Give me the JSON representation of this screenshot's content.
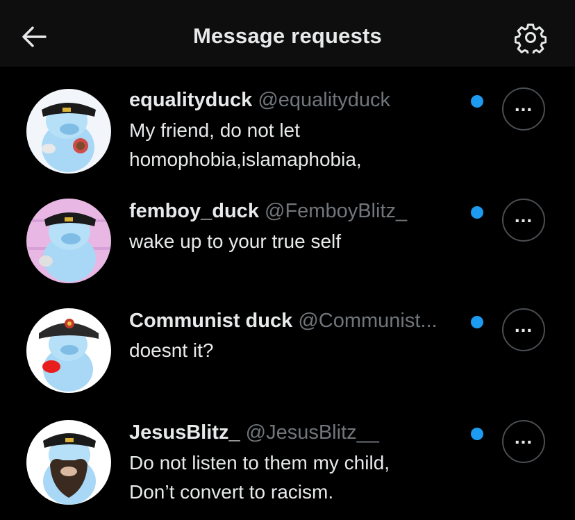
{
  "header": {
    "title": "Message requests",
    "back_icon": "arrow-left-icon",
    "settings_icon": "gear-icon"
  },
  "requests": [
    {
      "name": "equalityduck",
      "handle": "@equalityduck",
      "message_lines": [
        "My friend, do not let",
        "homophobia,islamaphobia,"
      ],
      "unread": true,
      "avatar_bg": "#f2f6fb"
    },
    {
      "name": "femboy_duck",
      "handle": "@FemboyBlitz_",
      "message_lines": [
        "wake up to your true self"
      ],
      "unread": true,
      "avatar_bg": "#e9b7e4"
    },
    {
      "name": "Communist duck",
      "handle": "@Communist...",
      "message_lines": [
        "doesnt it?"
      ],
      "unread": true,
      "avatar_bg": "#ffffff"
    },
    {
      "name": "JesusBlitz_",
      "handle": "@JesusBlitz__",
      "message_lines": [
        "Do not listen to them my child,",
        "Don’t convert to racism."
      ],
      "unread": true,
      "avatar_bg": "#ffffff"
    }
  ],
  "more_icon": "more-horizontal-icon",
  "colors": {
    "background": "#000000",
    "header_bg": "#0e0e0e",
    "text": "#e7e9ea",
    "secondary_text": "#71767b",
    "unread_dot": "#1d9bf0",
    "button_border": "#4a4e52"
  }
}
